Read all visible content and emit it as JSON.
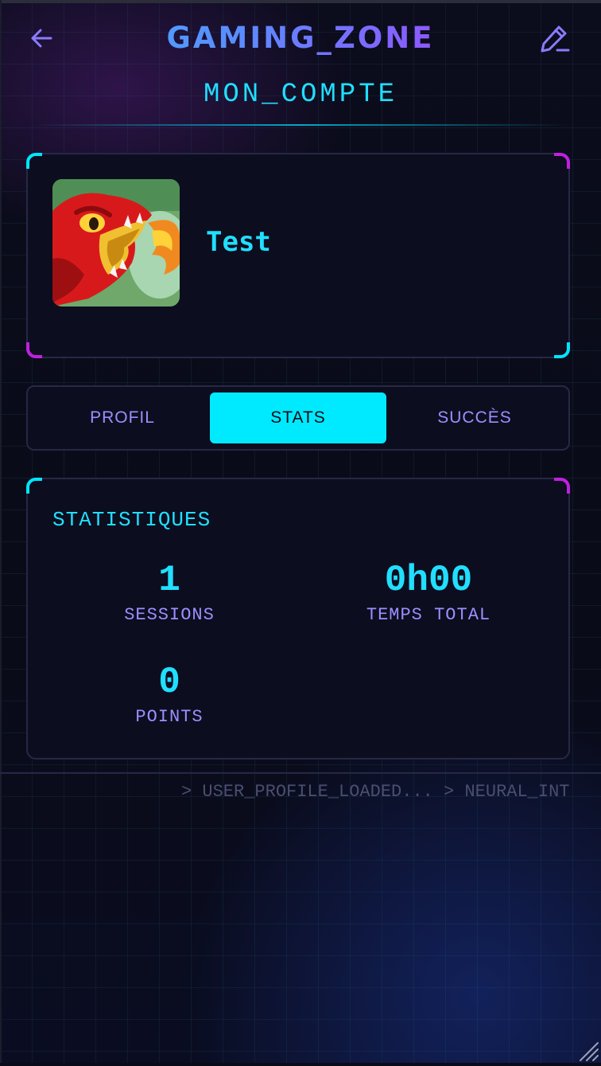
{
  "header": {
    "app_title": "GAMING_ZONE",
    "page_title": "MON_COMPTE",
    "back_icon": "arrow-left-icon",
    "edit_icon": "pencil-icon"
  },
  "profile": {
    "username": "Test",
    "avatar": "red-dragon-fire-avatar"
  },
  "tabs": [
    {
      "label": "PROFIL",
      "active": false
    },
    {
      "label": "STATS",
      "active": true
    },
    {
      "label": "SUCCÈS",
      "active": false
    }
  ],
  "stats": {
    "heading": "STATISTIQUES",
    "items": [
      {
        "value": "1",
        "label": "SESSIONS"
      },
      {
        "value": "0h00",
        "label": "TEMPS TOTAL"
      },
      {
        "value": "0",
        "label": "POINTS"
      }
    ]
  },
  "log": {
    "text": "> USER_PROFILE_LOADED... > NEURAL_INT"
  },
  "colors": {
    "accent_cyan": "#00eaff",
    "accent_purple": "#9a90ff",
    "corner_magenta": "#c020e0",
    "background": "#0a0b18"
  }
}
